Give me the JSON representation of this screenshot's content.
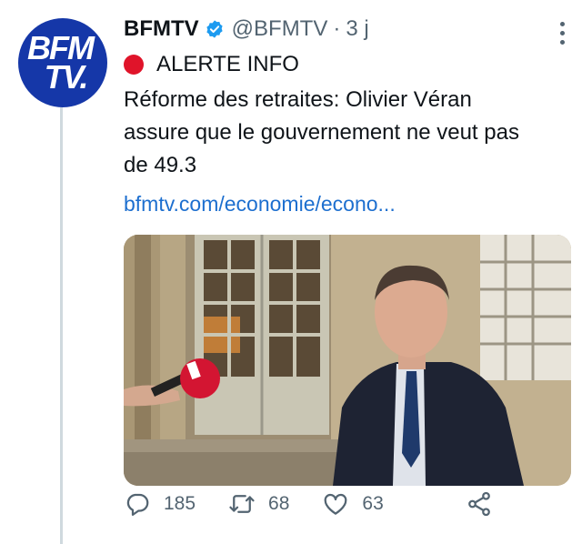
{
  "tweet": {
    "author_name": "BFMTV",
    "handle": "@BFMTV",
    "separator": "·",
    "time": "3 j",
    "alert_label": "ALERTE INFO",
    "text_line1": "Réforme des retraites: Olivier Véran",
    "text_line2": "assure que le gouvernement ne veut pas",
    "text_line3": "de 49.3",
    "link_text": "bfmtv.com/economie/econo..."
  },
  "avatar": {
    "logo_line1": "BFM",
    "logo_line2": "TV."
  },
  "actions": {
    "replies": "185",
    "retweets": "68",
    "likes": "63"
  },
  "colors": {
    "brand_blue": "#1537a8",
    "alert_red": "#e0142a",
    "verified_blue": "#1d9bf0",
    "link_blue": "#1d6fcf",
    "meta_gray": "#536471"
  },
  "icons": [
    "verified-badge-icon",
    "more-icon",
    "alert-dot-icon",
    "reply-icon",
    "retweet-icon",
    "like-icon",
    "share-icon"
  ]
}
